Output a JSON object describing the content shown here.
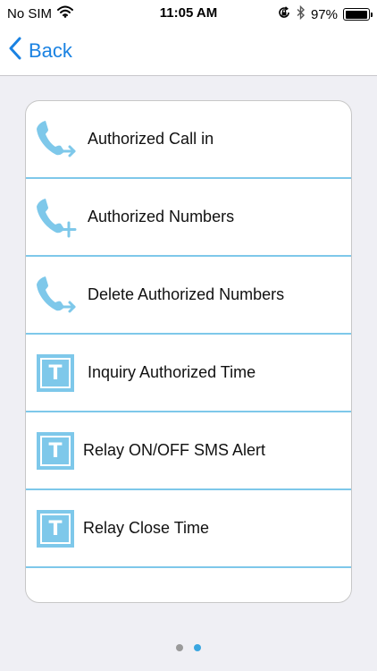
{
  "status_bar": {
    "carrier": "No SIM",
    "time": "11:05 AM",
    "battery_percent": "97%",
    "battery_level": 0.97
  },
  "nav": {
    "back_label": "Back"
  },
  "menu": {
    "items": [
      {
        "label": "Authorized Call in",
        "icon": "phone-arrow-icon"
      },
      {
        "label": "Authorized Numbers",
        "icon": "phone-plus-icon"
      },
      {
        "label": "Delete Authorized Numbers",
        "icon": "phone-arrow-icon"
      },
      {
        "label": "Inquiry Authorized Time",
        "icon": "t-box-icon",
        "icon_letter": "T"
      },
      {
        "label": "Relay ON/OFF SMS Alert",
        "icon": "t-box-icon",
        "icon_letter": "T"
      },
      {
        "label": "Relay Close Time",
        "icon": "t-box-icon",
        "icon_letter": "T"
      }
    ]
  },
  "pagination": {
    "total_pages": 2,
    "current_page": 2
  },
  "colors": {
    "accent": "#1a82e2",
    "icon_blue": "#7ec8ea",
    "divider": "#7ec8ea"
  }
}
